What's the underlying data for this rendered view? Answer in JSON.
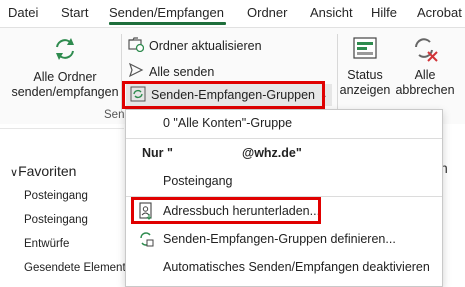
{
  "tabs": [
    "Datei",
    "Start",
    "Senden/Empfangen",
    "Ordner",
    "Ansicht",
    "Hilfe",
    "Acrobat"
  ],
  "active_tab_index": 2,
  "ribbon": {
    "all_folders_line1": "Alle Ordner",
    "all_folders_line2": "senden/empfangen",
    "update_folder": "Ordner aktualisieren",
    "send_all": "Alle senden",
    "sendreceive_groups": "Senden-Empfangen-Gruppen",
    "group_label_partial": "Sen",
    "status_line1": "Status",
    "status_line2": "anzeigen",
    "cancel_line1": "Alle",
    "cancel_line2": "abbrechen"
  },
  "dropdown": {
    "item_all_accounts": "0 \"Alle Konten\"-Gruppe",
    "nur_label": "Nur \"",
    "account_domain": "@whz.de\"",
    "posteingang": "Posteingang",
    "download_addressbook": "Adressbuch herunterladen...",
    "define_groups": "Senden-Empfangen-Gruppen definieren...",
    "auto_sendreceive": "Automatisches Senden/Empfangen deaktivieren"
  },
  "left_pane": {
    "favorites": "Favoriten",
    "items": [
      "Posteingang",
      "Posteingang",
      "Entwürfe",
      "Gesendete Elemente"
    ]
  },
  "right_pane_char": "n",
  "colors": {
    "accent": "#1e6e3b",
    "highlight": "#e00000"
  }
}
